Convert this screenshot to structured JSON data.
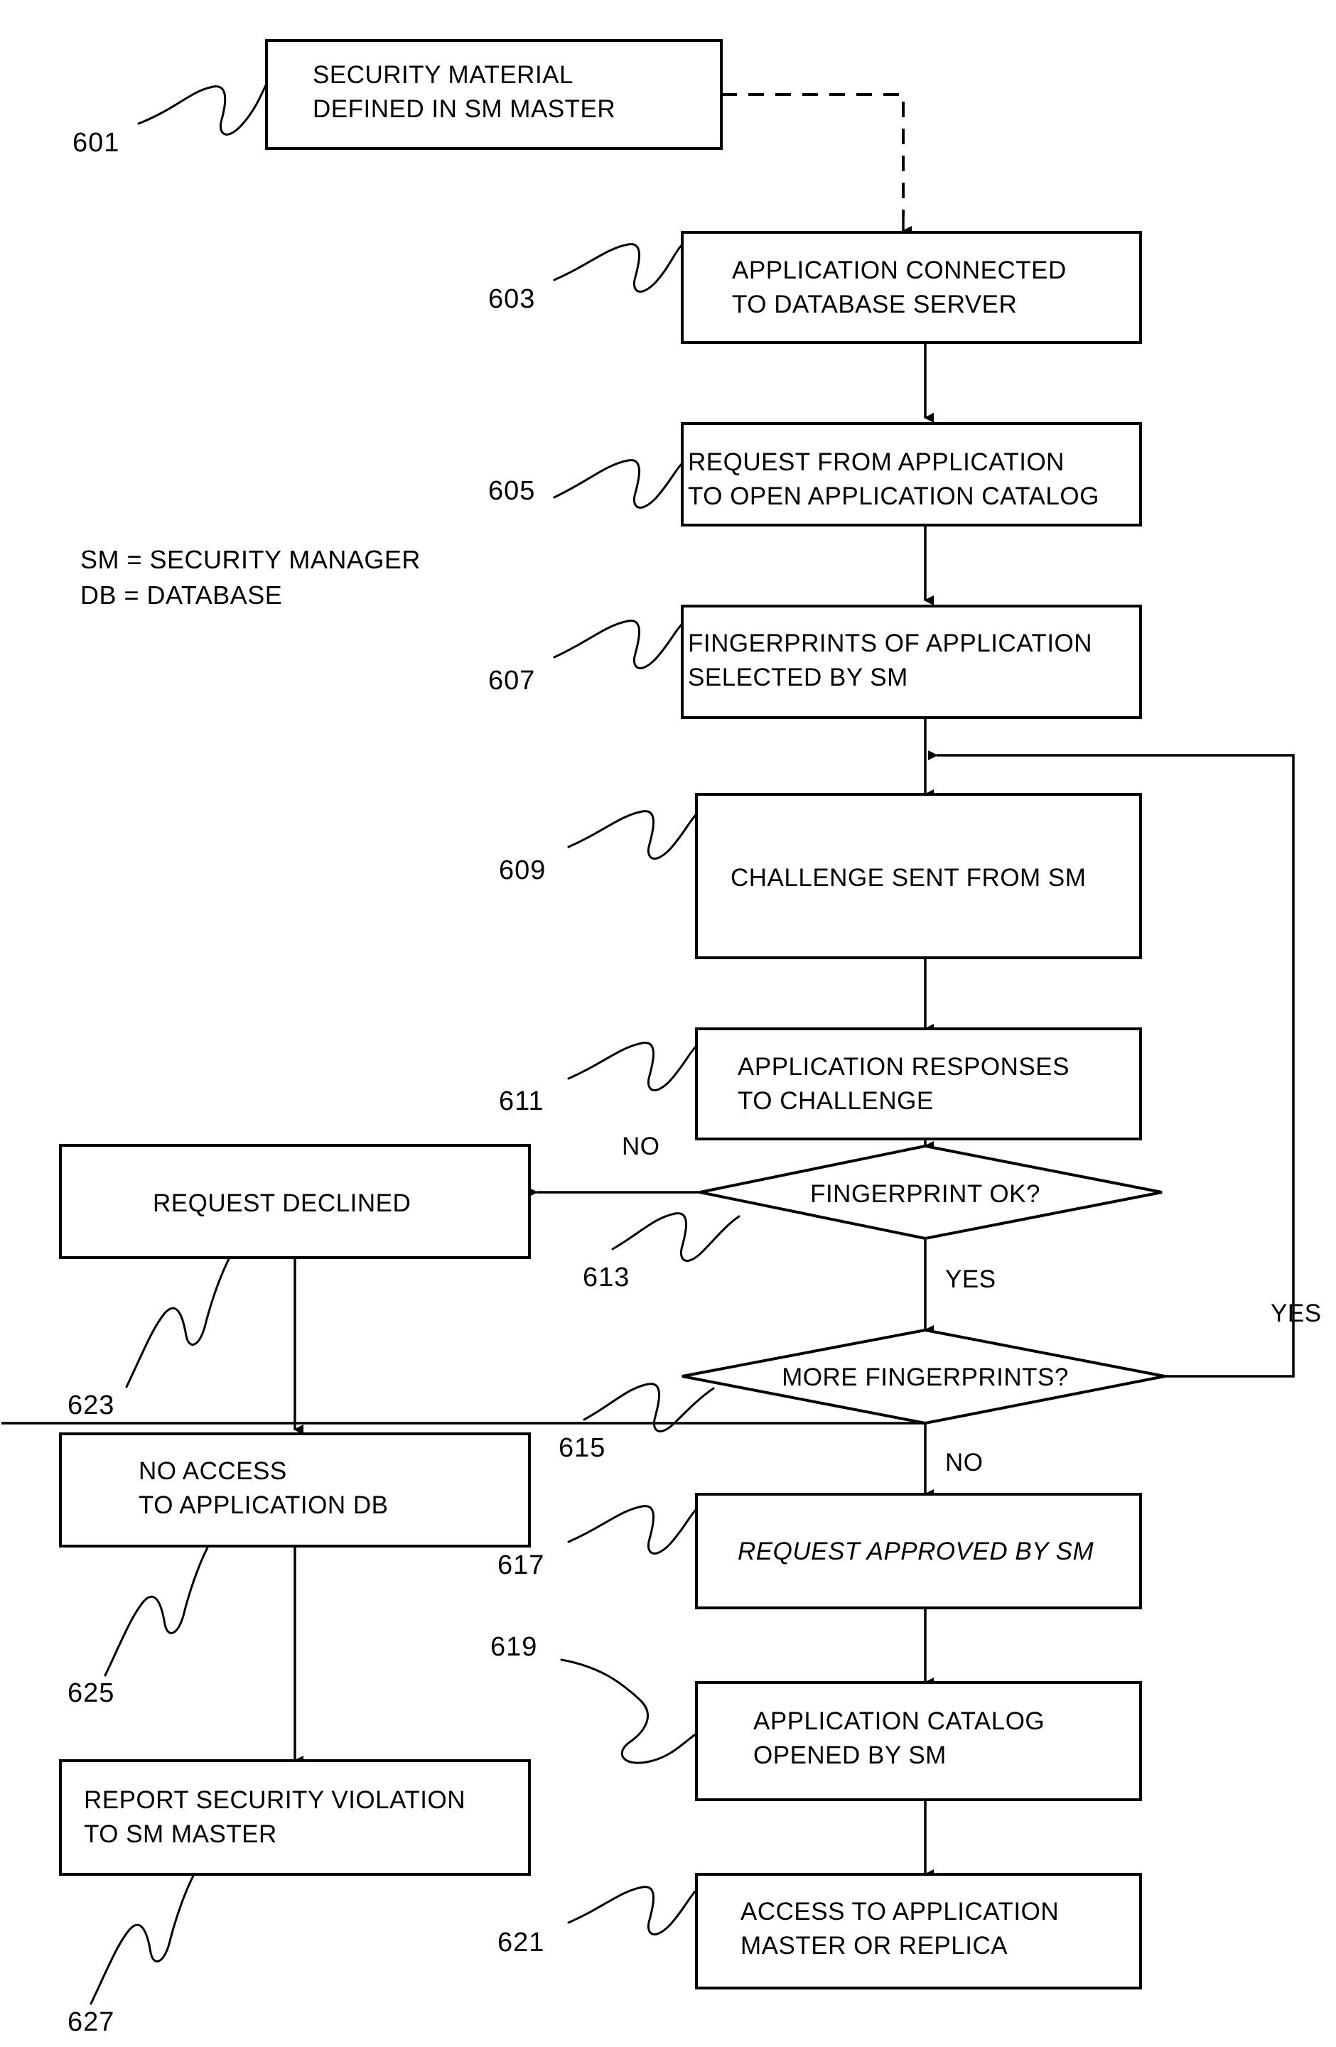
{
  "figure": {
    "type": "patent-flowchart",
    "legend": [
      "SM = SECURITY MANAGER",
      "DB = DATABASE"
    ]
  },
  "nodes": [
    {
      "ref": "601",
      "shape": "process",
      "lines": [
        "SECURITY MATERIAL",
        "DEFINED IN SM MASTER"
      ],
      "italic": false
    },
    {
      "ref": "603",
      "shape": "process",
      "lines": [
        "APPLICATION CONNECTED",
        "TO DATABASE SERVER"
      ],
      "italic": false
    },
    {
      "ref": "605",
      "shape": "process",
      "lines": [
        "REQUEST FROM APPLICATION",
        "TO OPEN APPLICATION CATALOG"
      ],
      "italic": false
    },
    {
      "ref": "607",
      "shape": "process",
      "lines": [
        "FINGERPRINTS OF APPLICATION",
        "SELECTED BY SM"
      ],
      "italic": false
    },
    {
      "ref": "609",
      "shape": "process",
      "lines": [
        "CHALLENGE SENT FROM SM"
      ],
      "italic": false
    },
    {
      "ref": "611",
      "shape": "process",
      "lines": [
        "APPLICATION RESPONSES",
        "TO CHALLENGE"
      ],
      "italic": false
    },
    {
      "ref": "613",
      "shape": "decision",
      "lines": [
        "FINGERPRINT OK?"
      ],
      "italic": false
    },
    {
      "ref": "615",
      "shape": "decision",
      "lines": [
        "MORE FINGERPRINTS?"
      ],
      "italic": false
    },
    {
      "ref": "617",
      "shape": "process",
      "lines": [
        "REQUEST APPROVED BY SM"
      ],
      "italic": true
    },
    {
      "ref": "619",
      "shape": "process",
      "lines": [
        "APPLICATION CATALOG",
        "OPENED BY SM"
      ],
      "italic": false
    },
    {
      "ref": "621",
      "shape": "process",
      "lines": [
        "ACCESS TO APPLICATION",
        "MASTER OR REPLICA"
      ],
      "italic": false
    },
    {
      "ref": "623",
      "shape": "process",
      "lines": [
        "REQUEST DECLINED"
      ],
      "italic": false
    },
    {
      "ref": "625",
      "shape": "process",
      "lines": [
        "NO ACCESS",
        "TO APPLICATION DB"
      ],
      "italic": false
    },
    {
      "ref": "627",
      "shape": "process",
      "lines": [
        "REPORT SECURITY VIOLATION",
        "TO SM MASTER"
      ],
      "italic": false
    }
  ],
  "branch_labels": {
    "fingerprint_no": "NO",
    "fingerprint_yes": "YES",
    "more_yes": "YES",
    "more_no": "NO"
  }
}
